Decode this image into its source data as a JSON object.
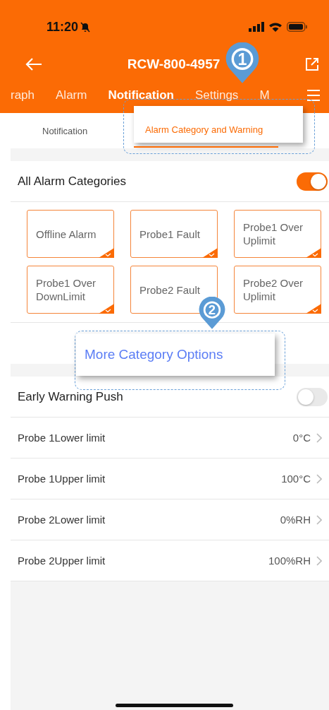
{
  "status_bar": {
    "time": "11:20"
  },
  "header": {
    "title": "RCW-800-4957"
  },
  "tabs": [
    {
      "label": "raph",
      "selected": false
    },
    {
      "label": "Alarm",
      "selected": false
    },
    {
      "label": "Notification",
      "selected": true
    },
    {
      "label": "Settings",
      "selected": false
    },
    {
      "label": "M",
      "selected": false
    }
  ],
  "sub_tabs": [
    {
      "label": "Notification",
      "selected": false
    },
    {
      "label": "Alarm Category and Warning",
      "selected": true
    }
  ],
  "all_alarm": {
    "label": "All Alarm Categories",
    "on": true
  },
  "categories": [
    {
      "label": "Offline Alarm",
      "checked": true
    },
    {
      "label": "Probe1 Fault",
      "checked": true
    },
    {
      "label": "Probe1 Over Uplimit",
      "checked": true
    },
    {
      "label": "Probe1 Over DownLimit",
      "checked": true
    },
    {
      "label": "Probe2 Fault",
      "checked": true
    },
    {
      "label": "Probe2 Over Uplimit",
      "checked": true
    }
  ],
  "more_link": "More Category Options",
  "early_warning": {
    "label": "Early Warning Push",
    "on": false
  },
  "limits": [
    {
      "label": "Probe 1Lower limit",
      "value": "0°C"
    },
    {
      "label": "Probe 1Upper limit",
      "value": "100°C"
    },
    {
      "label": "Probe 2Lower limit",
      "value": "0%RH"
    },
    {
      "label": "Probe 2Upper limit",
      "value": "100%RH"
    }
  ],
  "markers": [
    "1",
    "2"
  ]
}
